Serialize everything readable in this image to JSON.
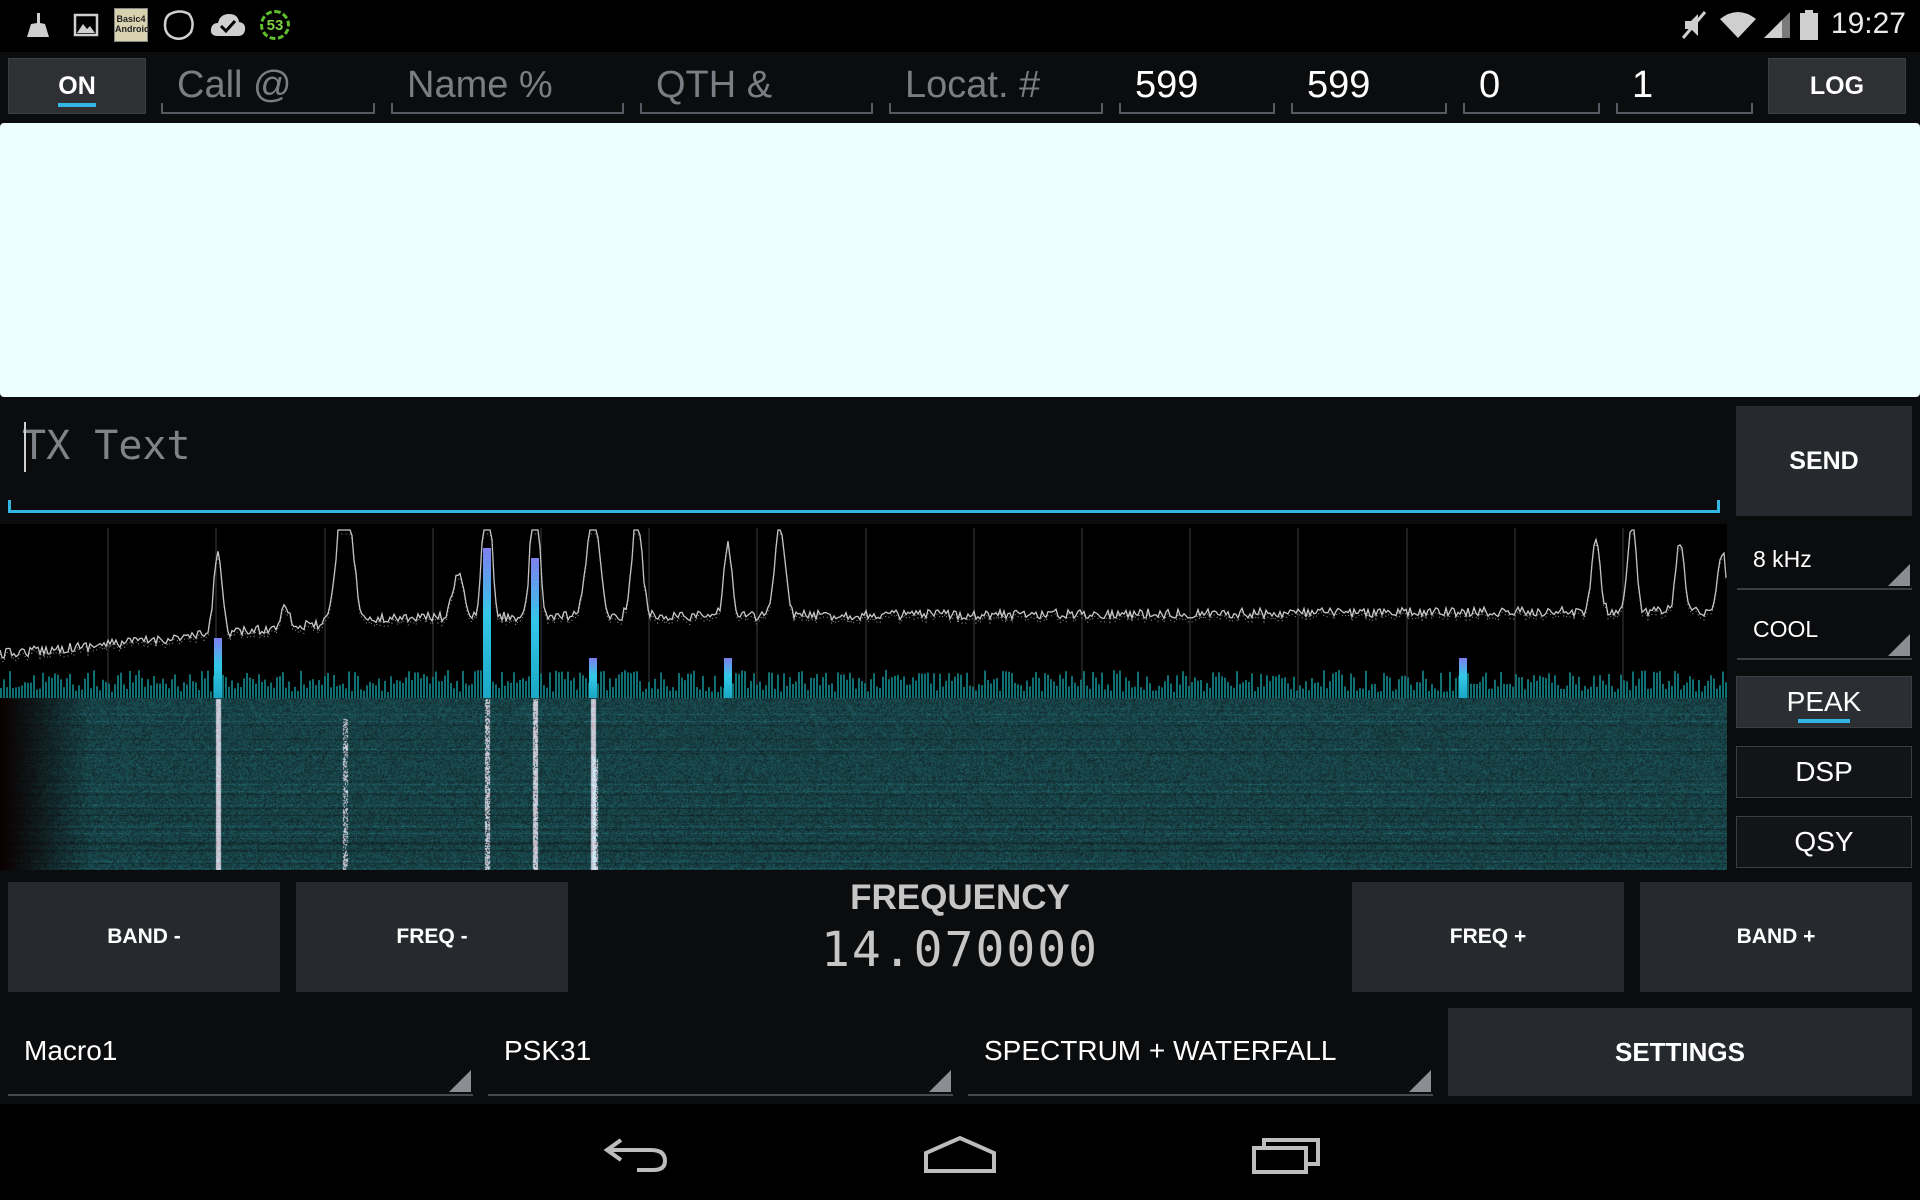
{
  "status_bar": {
    "time": "19:27",
    "notification_icons": [
      "cleaner-icon",
      "image-icon",
      "basic4android-icon",
      "blob-icon",
      "cloud-check-icon",
      "counter-badge-icon"
    ],
    "badge_count": "53",
    "basic4android_text": "Basic4 Android",
    "system_icons": [
      "mute-icon",
      "wifi-icon",
      "signal-icon",
      "battery-icon"
    ]
  },
  "top_bar": {
    "on_label": "ON",
    "call_placeholder": "Call @",
    "name_placeholder": "Name %",
    "qth_placeholder": "QTH &",
    "locator_placeholder": "Locat. #",
    "rst_sent": "599",
    "rst_received": "599",
    "field_zero": "0",
    "field_one": "1",
    "log_label": "LOG"
  },
  "tx": {
    "placeholder": "TX Text",
    "send_label": "SEND"
  },
  "display_controls": {
    "span": "8 kHz",
    "palette": "COOL",
    "peak_label": "PEAK",
    "dsp_label": "DSP",
    "qsy_label": "QSY"
  },
  "tuning": {
    "band_minus": "BAND -",
    "freq_minus": "FREQ -",
    "title": "FREQUENCY",
    "frequency": "14.070000",
    "freq_plus": "FREQ +",
    "band_plus": "BAND +"
  },
  "bottom": {
    "macro": "Macro1",
    "mode": "PSK31",
    "view": "SPECTRUM + WATERFALL",
    "settings_label": "SETTINGS"
  },
  "colors": {
    "accent": "#33b5e5",
    "rx_background": "#eeffff",
    "waterfall": "#0e8a90"
  },
  "nav_bar": [
    "back-icon",
    "home-icon",
    "recents-icon"
  ]
}
